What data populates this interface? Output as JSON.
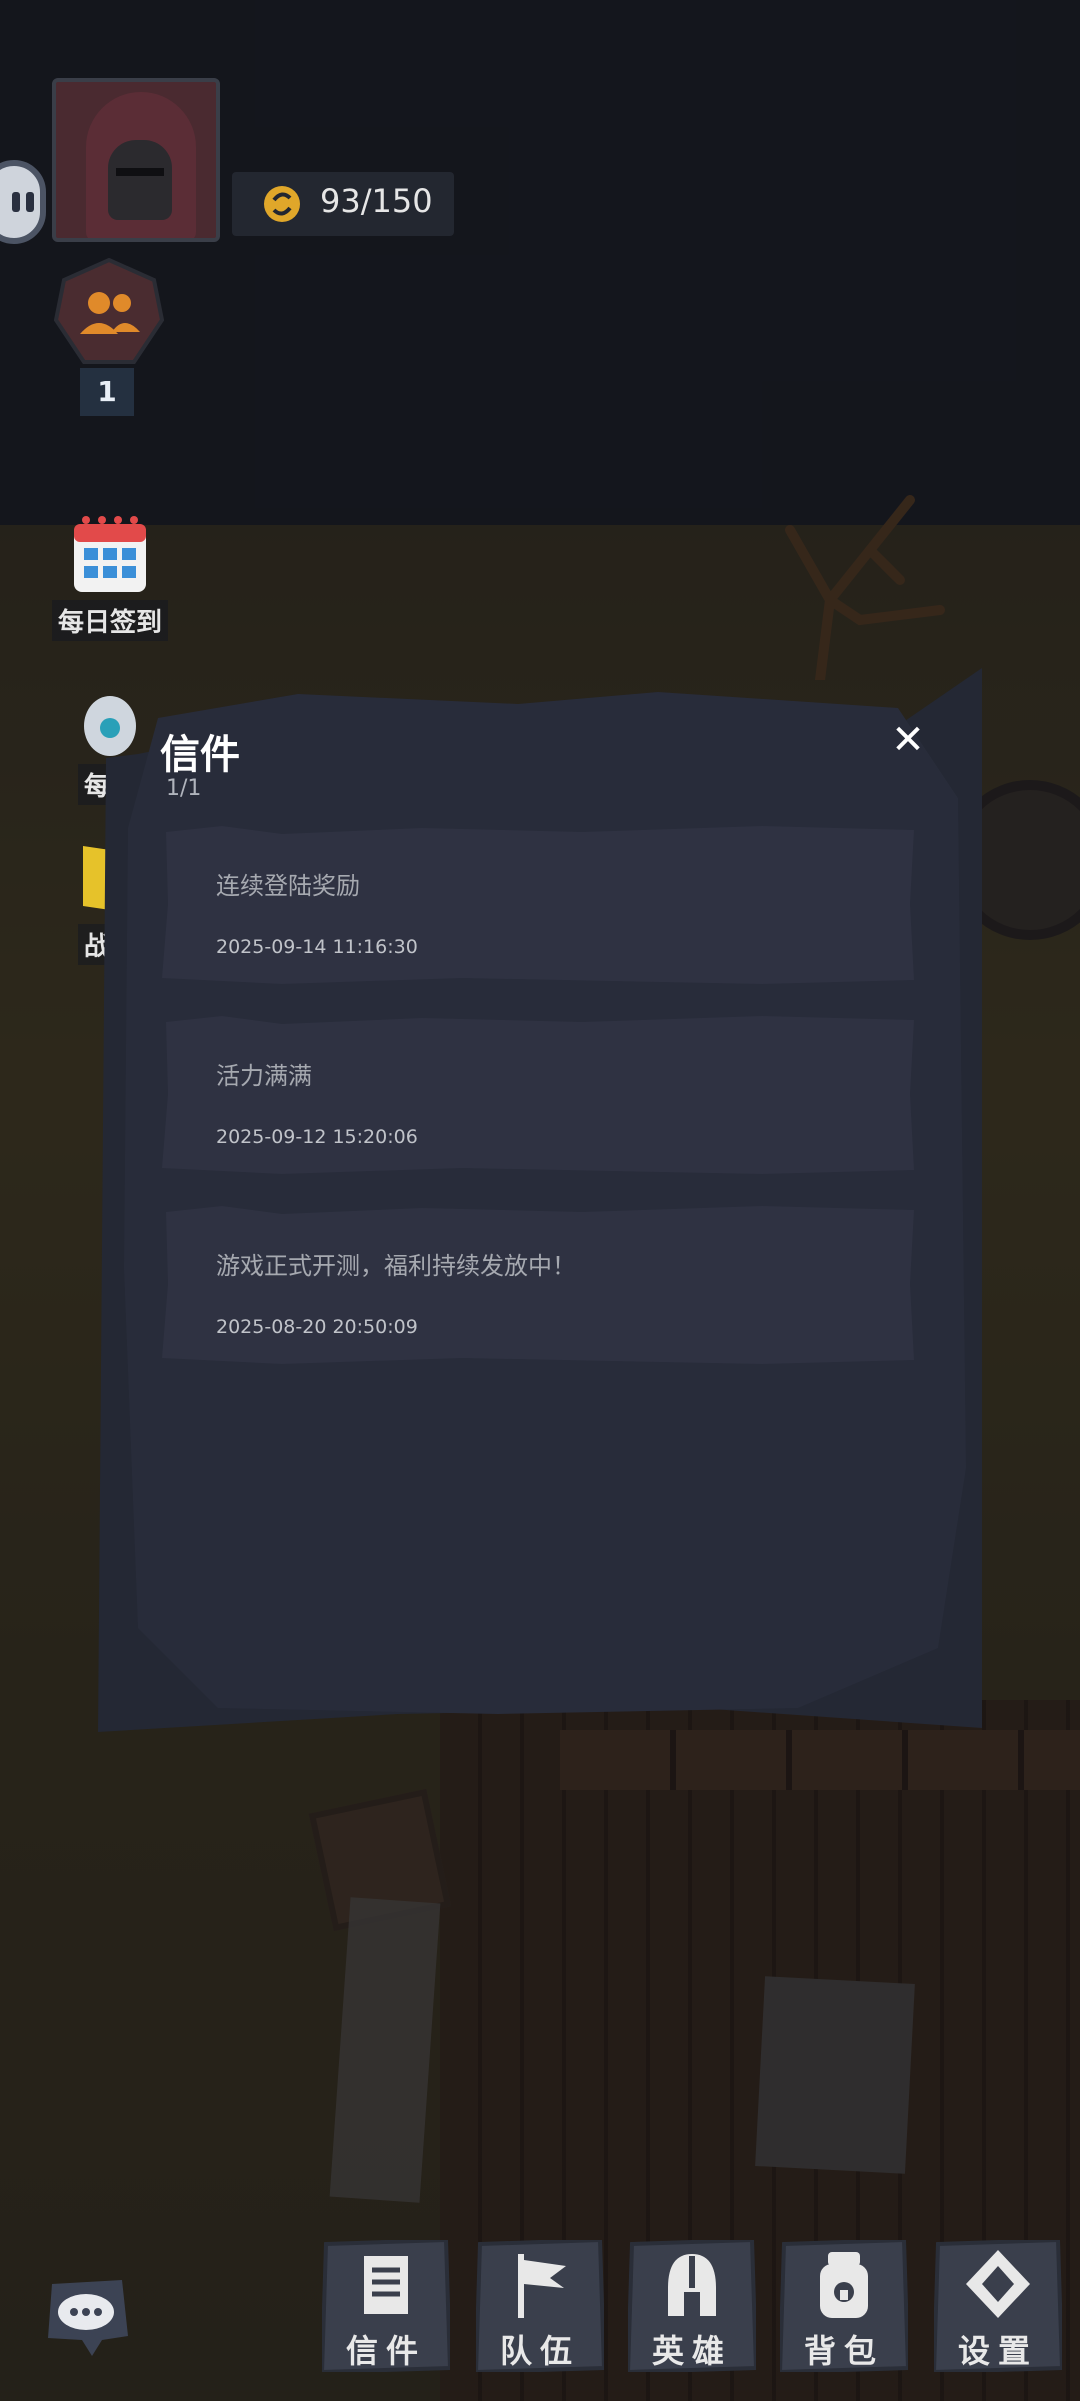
{
  "hud": {
    "energy_value": "93/150",
    "team_count": "1"
  },
  "left_features": [
    {
      "label": "每日签到",
      "icon": "calendar-icon"
    },
    {
      "label": "每日",
      "icon": "potion-bag-icon"
    },
    {
      "label": "战旗",
      "icon": "banner-icon"
    }
  ],
  "mail_panel": {
    "title": "信件",
    "page": "1/1",
    "close_label": "✕",
    "items": [
      {
        "subject": "连续登陆奖励",
        "date": "2025-09-14 11:16:30"
      },
      {
        "subject": "活力满满",
        "date": "2025-09-12 15:20:06"
      },
      {
        "subject": "游戏正式开测，福利持续发放中！",
        "date": "2025-08-20 20:50:09"
      }
    ]
  },
  "bottom_nav": [
    {
      "label": "信件",
      "icon": "letter-icon"
    },
    {
      "label": "队伍",
      "icon": "flag-icon"
    },
    {
      "label": "英雄",
      "icon": "helmet-icon"
    },
    {
      "label": "背包",
      "icon": "backpack-icon"
    },
    {
      "label": "设置",
      "icon": "settings-diamond-icon"
    }
  ],
  "colors": {
    "panel_bg": "#242834",
    "item_bg": "#2f3242",
    "energy_coin": "#e0a72a",
    "team_icon": "#e08a2a"
  }
}
